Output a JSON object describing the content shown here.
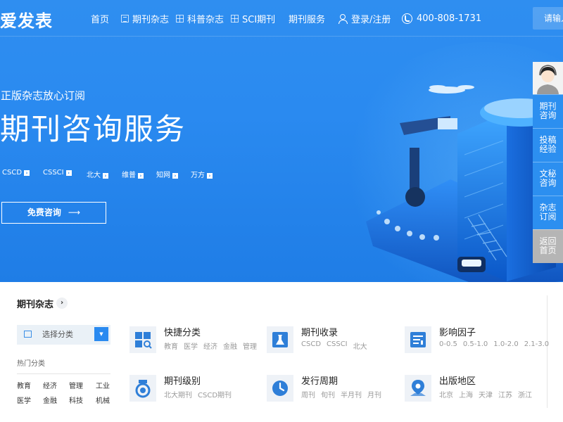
{
  "brand": {
    "logo_text": "爱发表"
  },
  "nav": {
    "items": [
      {
        "label": "首页",
        "icon": ""
      },
      {
        "label": "期刊杂志",
        "icon": "journal-icon"
      },
      {
        "label": "科普杂志",
        "icon": "grid-icon"
      },
      {
        "label": "SCI期刊",
        "icon": "grid-icon"
      },
      {
        "label": "期刊服务",
        "icon": ""
      }
    ],
    "login_label": "登录/注册",
    "phone": "400-808-1731",
    "search_placeholder": "请输入"
  },
  "hero": {
    "subtitle": "正版杂志放心订阅",
    "title": "期刊咨询服务",
    "tags": [
      "CSCD",
      "CSSCI",
      "北大",
      "维普",
      "知网",
      "万方"
    ],
    "cta_label": "免费咨询",
    "cta_arrow": "⟶"
  },
  "sidebar": {
    "buttons": [
      {
        "label": "期刊咨询"
      },
      {
        "label": "投稿经验"
      },
      {
        "label": "文秘咨询"
      },
      {
        "label": "杂志订阅"
      },
      {
        "label": "返回首页"
      }
    ]
  },
  "section": {
    "title": "期刊杂志",
    "more_glyph": "›",
    "category_placeholder": "选择分类",
    "hot_label": "热门分类",
    "hot_items": [
      "教育",
      "经济",
      "管理",
      "工业",
      "医学",
      "金融",
      "科技",
      "机械"
    ],
    "cards": [
      {
        "title": "快捷分类",
        "subs": [
          "教育",
          "医学",
          "经济",
          "金融",
          "管理"
        ]
      },
      {
        "title": "期刊收录",
        "subs": [
          "CSCD",
          "CSSCI",
          "北大"
        ]
      },
      {
        "title": "影响因子",
        "subs": [
          "0-0.5",
          "0.5-1.0",
          "1.0-2.0",
          "2.1-3.0"
        ]
      },
      {
        "title": "期刊级别",
        "subs": [
          "北大期刊",
          "CSCD期刊"
        ]
      },
      {
        "title": "发行周期",
        "subs": [
          "周刊",
          "旬刊",
          "半月刊",
          "月刊"
        ]
      },
      {
        "title": "出版地区",
        "subs": [
          "北京",
          "上海",
          "天津",
          "江苏",
          "浙江"
        ]
      }
    ]
  },
  "colors": {
    "primary": "#2a8af0",
    "hero_dark": "#1f7de6",
    "icon_bg": "#eef2f7",
    "accent_icon": "#2f7fd8"
  }
}
